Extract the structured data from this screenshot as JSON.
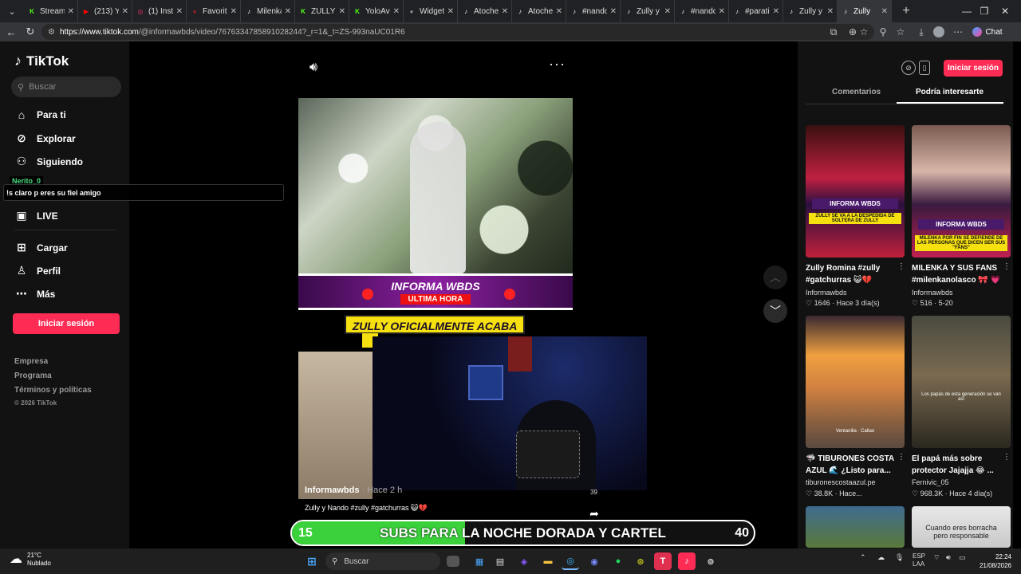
{
  "browser": {
    "tabs": [
      {
        "label": "Stream",
        "icon": "kick-icon",
        "color": "#53fc18"
      },
      {
        "label": "(213) You",
        "icon": "youtube-icon",
        "color": "#ff0000"
      },
      {
        "label": "(1) Insta",
        "icon": "instagram-icon",
        "color": "#e1306c"
      },
      {
        "label": "Favorito",
        "icon": "bookmark-icon",
        "color": "#a0202a"
      },
      {
        "label": "Milenka",
        "icon": "tiktok-icon",
        "color": "#ffffff"
      },
      {
        "label": "ZULLY",
        "icon": "kick-icon",
        "color": "#53fc18"
      },
      {
        "label": "YoloAve",
        "icon": "kick-icon",
        "color": "#53fc18"
      },
      {
        "label": "Widget",
        "icon": "widget-icon",
        "color": "#888888"
      },
      {
        "label": "Atoche",
        "icon": "tiktok-icon",
        "color": "#ffffff"
      },
      {
        "label": "Atoche",
        "icon": "tiktok-icon",
        "color": "#ffffff"
      },
      {
        "label": "#nando",
        "icon": "tiktok-icon",
        "color": "#ffffff"
      },
      {
        "label": "Zully y N",
        "icon": "tiktok-icon",
        "color": "#ffffff"
      },
      {
        "label": "#nando",
        "icon": "tiktok-icon",
        "color": "#ffffff"
      },
      {
        "label": "#parati",
        "icon": "tiktok-icon",
        "color": "#ffffff"
      },
      {
        "label": "Zully y N",
        "icon": "tiktok-icon",
        "color": "#ffffff"
      },
      {
        "label": "Zully",
        "icon": "tiktok-icon",
        "color": "#ffffff",
        "active": true
      }
    ],
    "url_host": "https://www.tiktok.com",
    "url_path": "/@informawbds/video/7676334785891028244?_r=1&_t=ZS-993naUC01R6",
    "chat_label": "Chat"
  },
  "sidebar": {
    "logo_text": "TikTok",
    "search_placeholder": "Buscar",
    "nav": [
      {
        "label": "Para ti",
        "icon": "home-icon"
      },
      {
        "label": "Explorar",
        "icon": "compass-icon"
      },
      {
        "label": "Siguiendo",
        "icon": "following-icon"
      },
      {
        "label": "LIVE",
        "icon": "live-icon"
      },
      {
        "label": "Cargar",
        "icon": "upload-icon"
      },
      {
        "label": "Perfil",
        "icon": "profile-icon"
      },
      {
        "label": "Más",
        "icon": "more-icon"
      }
    ],
    "login_label": "Iniciar sesión",
    "footer": [
      "Empresa",
      "Programa",
      "Términos y políticas"
    ],
    "copyright": "© 2026 TikTok"
  },
  "chat_overlay": {
    "username": "Nerito_0",
    "message": "!s claro p eres su fiel amigo"
  },
  "video": {
    "banner_title": "INFORMA WBDS",
    "banner_sub": "ULTIMA HORA",
    "headline": "ZULLY OFICIALMENTE ACABA",
    "author": "Informawbds",
    "time": "· Hace 2 h",
    "description": "Zully y Nando #zully #gatchurras 😺💔",
    "share_count": "39"
  },
  "sub_goal": {
    "current": "15",
    "target": "40",
    "label": "SUBS PARA LA NOCHE DORADA Y CARTEL",
    "progress": 0.375,
    "color": "#3ad13a"
  },
  "right_panel": {
    "login_label": "Iniciar sesión",
    "tabs": [
      "Comentarios",
      "Podría interesarte"
    ],
    "active_tab": "Podría interesarte",
    "cards": [
      {
        "title": "Zully Romina #zully",
        "title2": "#gatchurras 😺💔",
        "author": "Informawbds",
        "stats": "♡ 1646 · Hace 3 día(s)",
        "tag": "INFORMA WBDS",
        "tag2": "ZULLY SE VA A LA DESPEDIDA DE SOLTERA DE ZULLY"
      },
      {
        "title": "MILENKA Y SUS FANS",
        "title2": "#milenkanolasco 🎀 💗",
        "author": "Informawbds",
        "stats": "♡ 516 · 5-20",
        "tag": "INFORMA WBDS",
        "tag2": "MILENKA POR FIN SE DEFIENDE DE LAS PERSONAS QUE DICEN SER SUS \"FANS\""
      },
      {
        "title": "🦈 TIBURONES COSTA",
        "title2": "AZUL 🌊 ¿Listo para...",
        "author": "tiburonescostaazul.pe",
        "stats": "♡ 38.8K · Hace...",
        "tag": "",
        "tag2": "Ventanilla · Callao"
      },
      {
        "title": "El papá más sobre",
        "title2": "protector Jajajja 😂 ...",
        "author": "Fernivic_05",
        "stats": "♡ 968.3K · Hace 4 día(s)",
        "tag": "",
        "tag2": "Los papás de esta generación se van así"
      },
      {
        "title": "",
        "title2": "",
        "author": "",
        "stats": "",
        "tag": "",
        "tag2": ""
      },
      {
        "title": "",
        "title2": "",
        "author": "",
        "stats": "",
        "tag": "",
        "tag2": "Cuando eres borracha pero responsable"
      }
    ]
  },
  "taskbar": {
    "weather_temp": "21°C",
    "weather_desc": "Nublado",
    "search_label": "Buscar",
    "lang": "ESP",
    "lang2": "LAA",
    "time": "22:24",
    "date": "21/08/2026"
  }
}
